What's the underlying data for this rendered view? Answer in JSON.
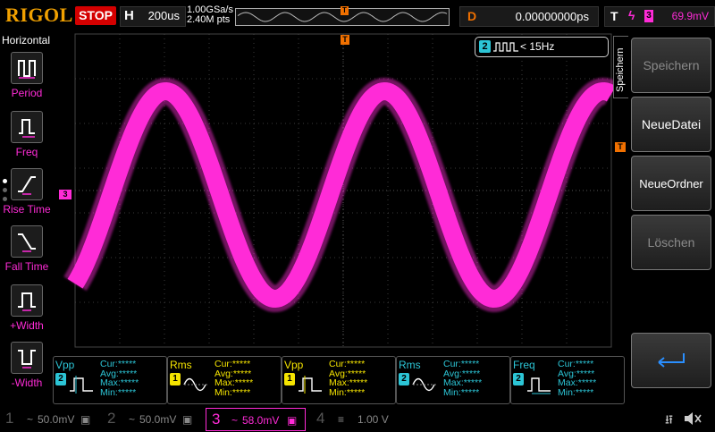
{
  "topbar": {
    "brand": "RIGOL",
    "run_state": "STOP",
    "timebase_key": "H",
    "timebase_value": "200us",
    "sample_rate": "1.00GSa/s",
    "memory_depth": "2.40M pts",
    "delay_key": "D",
    "delay_value": "0.00000000ps",
    "trigger_key": "T",
    "trigger_source": "3",
    "trigger_level": "69.9mV"
  },
  "left_menu": {
    "title": "Horizontal",
    "items": [
      {
        "label": "Period",
        "icon": "period-icon"
      },
      {
        "label": "Freq",
        "icon": "frequency-icon"
      },
      {
        "label": "Rise Time",
        "icon": "rise-time-icon"
      },
      {
        "label": "Fall Time",
        "icon": "fall-time-icon"
      },
      {
        "label": "+Width",
        "icon": "positive-width-icon"
      },
      {
        "label": "-Width",
        "icon": "negative-width-icon"
      }
    ]
  },
  "counter": {
    "channel": "2",
    "text": "< 15Hz"
  },
  "markers": {
    "trigger": "T",
    "ch3": "3",
    "trigger_level": "T"
  },
  "right_menu": {
    "tab": "Speichern",
    "buttons": [
      "Speichern",
      "NeueDatei",
      "NeueOrdner",
      "Löschen"
    ]
  },
  "measurements": [
    {
      "name": "Vpp",
      "source": "2",
      "color": "#2cc5d6",
      "cur": "Cur:*****",
      "avg": "Avg:*****",
      "max": "Max:*****",
      "min": "Min:*****"
    },
    {
      "name": "Rms",
      "source": "1",
      "color": "#f5e400",
      "cur": "Cur:*****",
      "avg": "Avg:*****",
      "max": "Max:*****",
      "min": "Min:*****"
    },
    {
      "name": "Vpp",
      "source": "1",
      "color": "#f5e400",
      "cur": "Cur:*****",
      "avg": "Avg:*****",
      "max": "Max:*****",
      "min": "Min:*****"
    },
    {
      "name": "Rms",
      "source": "2",
      "color": "#2cc5d6",
      "cur": "Cur:*****",
      "avg": "Avg:*****",
      "max": "Max:*****",
      "min": "Min:*****"
    },
    {
      "name": "Freq",
      "source": "2",
      "color": "#2cc5d6",
      "cur": "Cur:*****",
      "avg": "Avg:*****",
      "max": "Max:*****",
      "min": "Min:*****"
    }
  ],
  "channels": [
    {
      "num": "1",
      "scale": "50.0mV",
      "coupling": "~"
    },
    {
      "num": "2",
      "scale": "50.0mV",
      "coupling": "~"
    },
    {
      "num": "3",
      "scale": "58.0mV",
      "coupling": "~"
    },
    {
      "num": "4",
      "scale": "1.00 V",
      "coupling": "≡"
    }
  ],
  "colors": {
    "ch3": "#ff2bd7",
    "ch2": "#2cc5d6",
    "ch1": "#f5e400",
    "trigger": "#f07000",
    "stop": "#d40000"
  }
}
